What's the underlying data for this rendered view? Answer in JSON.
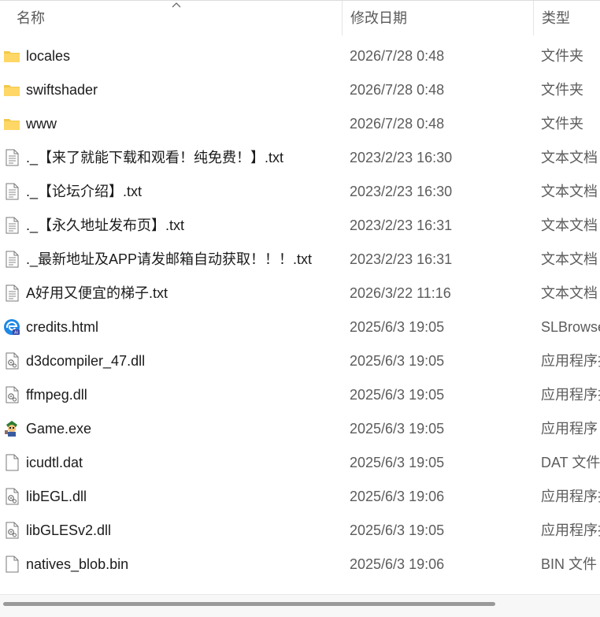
{
  "columns": {
    "name": "名称",
    "date": "修改日期",
    "type": "类型"
  },
  "files": [
    {
      "name": "locales",
      "date": "2026/7/28 0:48",
      "type": "文件夹",
      "icon": "folder-icon"
    },
    {
      "name": "swiftshader",
      "date": "2026/7/28 0:48",
      "type": "文件夹",
      "icon": "folder-icon"
    },
    {
      "name": "www",
      "date": "2026/7/28 0:48",
      "type": "文件夹",
      "icon": "folder-icon"
    },
    {
      "name": "._【来了就能下载和观看！纯免费！】.txt",
      "date": "2023/2/23 16:30",
      "type": "文本文档",
      "icon": "text-file-icon"
    },
    {
      "name": "._【论坛介绍】.txt",
      "date": "2023/2/23 16:30",
      "type": "文本文档",
      "icon": "text-file-icon"
    },
    {
      "name": "._【永久地址发布页】.txt",
      "date": "2023/2/23 16:31",
      "type": "文本文档",
      "icon": "text-file-icon"
    },
    {
      "name": "._最新地址及APP请发邮箱自动获取！！！.txt",
      "date": "2023/2/23 16:31",
      "type": "文本文档",
      "icon": "text-file-icon"
    },
    {
      "name": "A好用又便宜的梯子.txt",
      "date": "2026/3/22 11:16",
      "type": "文本文档",
      "icon": "text-file-icon"
    },
    {
      "name": "credits.html",
      "date": "2025/6/3 19:05",
      "type": "SLBrowse",
      "icon": "browser-html-icon"
    },
    {
      "name": "d3dcompiler_47.dll",
      "date": "2025/6/3 19:05",
      "type": "应用程序扩",
      "icon": "dll-file-icon"
    },
    {
      "name": "ffmpeg.dll",
      "date": "2025/6/3 19:05",
      "type": "应用程序扩",
      "icon": "dll-file-icon"
    },
    {
      "name": "Game.exe",
      "date": "2025/6/3 19:05",
      "type": "应用程序",
      "icon": "game-exe-icon"
    },
    {
      "name": "icudtl.dat",
      "date": "2025/6/3 19:05",
      "type": "DAT 文件",
      "icon": "blank-file-icon"
    },
    {
      "name": "libEGL.dll",
      "date": "2025/6/3 19:06",
      "type": "应用程序扩",
      "icon": "dll-file-icon"
    },
    {
      "name": "libGLESv2.dll",
      "date": "2025/6/3 19:05",
      "type": "应用程序扩",
      "icon": "dll-file-icon"
    },
    {
      "name": "natives_blob.bin",
      "date": "2025/6/3 19:06",
      "type": "BIN 文件",
      "icon": "blank-file-icon"
    }
  ],
  "scrollbar": {
    "horizontal_position": 0
  }
}
